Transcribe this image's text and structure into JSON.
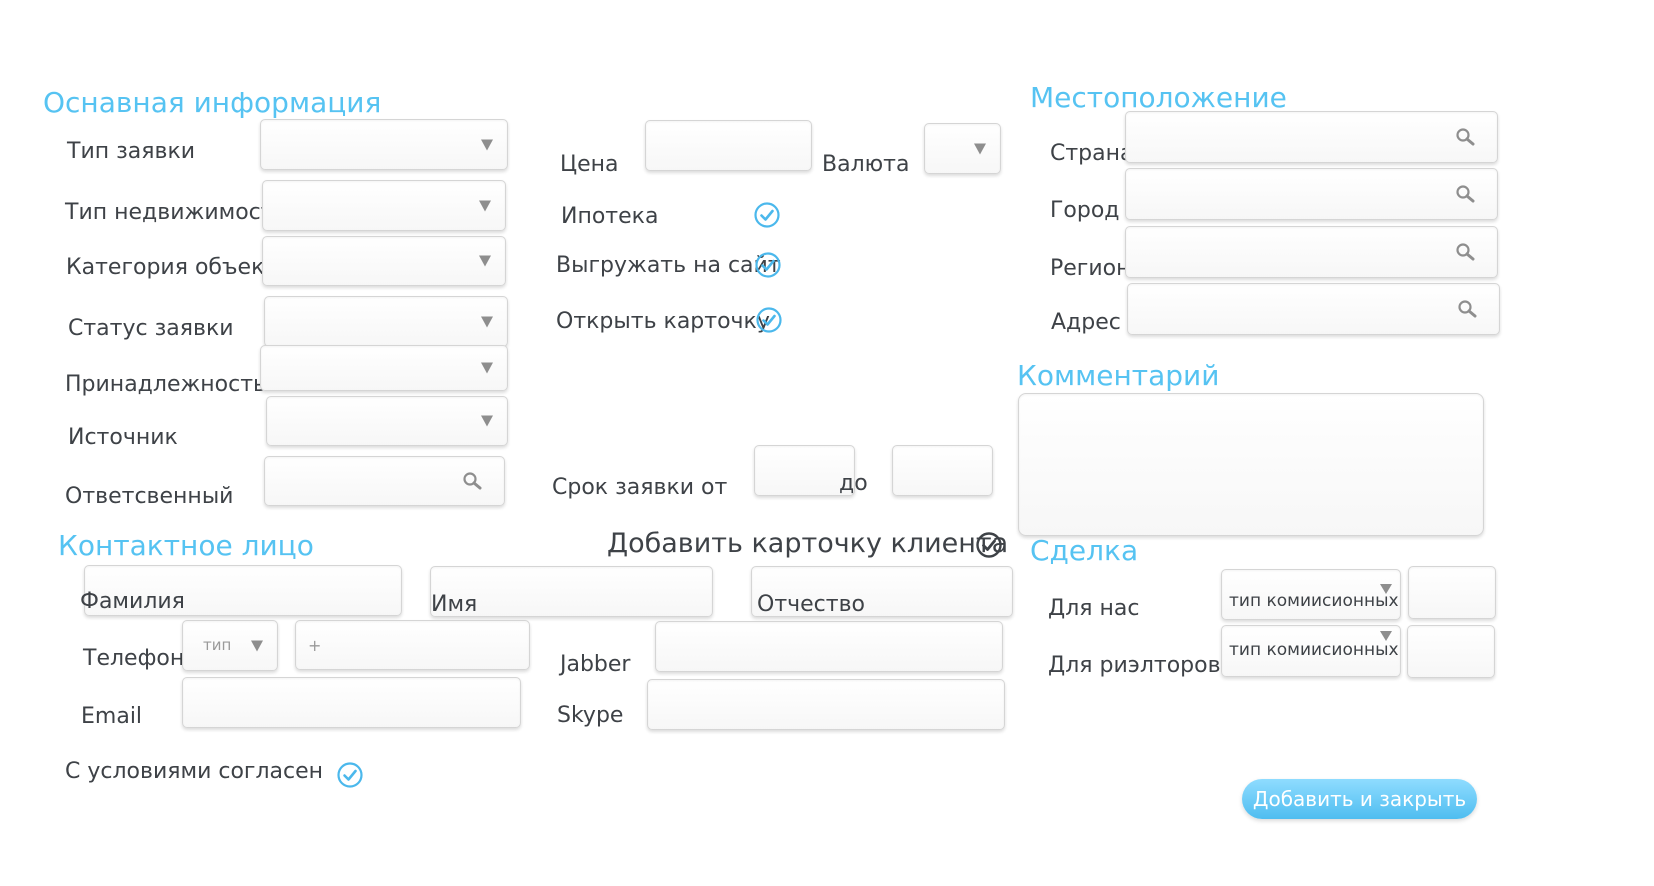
{
  "sections": {
    "main_info": "Оснавная информация",
    "location": "Местоположение",
    "comment": "Комментарий",
    "contact": "Контактное лицо",
    "deal": "Сделка"
  },
  "main": {
    "request_type": "Тип заявки",
    "property_type": "Тип недвижимости",
    "object_category": "Категория объекта",
    "request_status": "Статус заявки",
    "ownership": "Принадлежность",
    "source": "Источник",
    "responsible": "Ответсвенный"
  },
  "middle": {
    "price": "Цена",
    "currency": "Валюта",
    "mortgage": "Ипотека",
    "export_site": "Выгружать на сайт",
    "open_card": "Открыть карточку",
    "term_from": "Срок заявки  от",
    "term_to": "до",
    "add_client_card": "Добавить карточку клиента"
  },
  "location": {
    "country": "Страна",
    "city": "Город",
    "region": "Регион",
    "address": "Адрес"
  },
  "contact": {
    "surname": "Фамилия",
    "name": "Имя",
    "patronymic": "Отчество",
    "phone": "Телефон",
    "phone_type": "тип",
    "phone_value": "+",
    "email": "Email",
    "jabber": "Jabber",
    "skype": "Skype",
    "agree": "С условиями согласен"
  },
  "deal": {
    "for_us": "Для нас",
    "for_realtors": "Для риэлторов",
    "commission_type": "тип комиисионных"
  },
  "actions": {
    "add_close": "Добавить и закрыть"
  },
  "colors": {
    "accent": "#56c3f2",
    "text": "#3e4247",
    "check": "#4bb8ec"
  },
  "icons": [
    "chevron-down-icon",
    "search-icon",
    "check-circle-icon"
  ]
}
